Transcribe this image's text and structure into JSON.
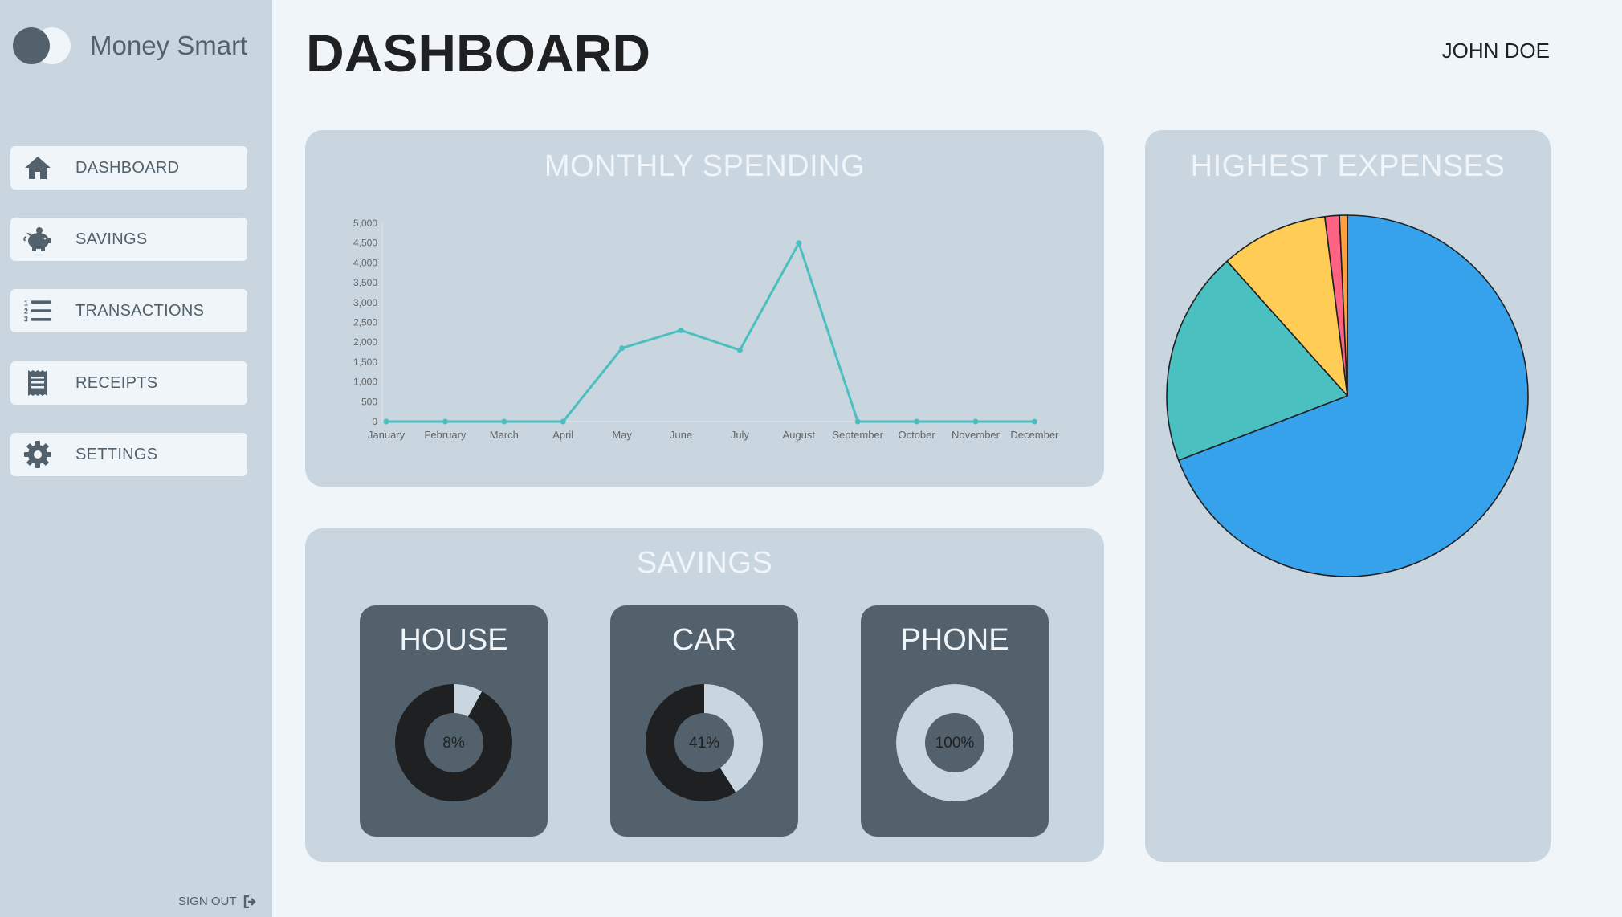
{
  "app": {
    "name": "Money Smart"
  },
  "sidebar": {
    "items": [
      {
        "label": "DASHBOARD",
        "icon": "home-icon"
      },
      {
        "label": "SAVINGS",
        "icon": "piggy-bank-icon"
      },
      {
        "label": "TRANSACTIONS",
        "icon": "numbered-list-icon"
      },
      {
        "label": "RECEIPTS",
        "icon": "receipt-icon"
      },
      {
        "label": "SETTINGS",
        "icon": "gear-icon"
      }
    ],
    "sign_out_label": "SIGN OUT"
  },
  "header": {
    "title": "DASHBOARD",
    "user": "JOHN DOE"
  },
  "colors": {
    "sidebar_bg": "#c9d6df",
    "page_bg": "#f0f5f9",
    "dark": "#52616b",
    "text": "#1e2022",
    "line": "#4bbfbf"
  },
  "monthly_spending": {
    "title": "MONTHLY SPENDING"
  },
  "highest_expenses": {
    "title": "HIGHEST EXPENSES"
  },
  "savings": {
    "title": "SAVINGS",
    "goals": [
      {
        "name": "HOUSE",
        "percent": 8,
        "label": "8%"
      },
      {
        "name": "CAR",
        "percent": 41,
        "label": "41%"
      },
      {
        "name": "PHONE",
        "percent": 100,
        "label": "100%"
      }
    ]
  },
  "chart_data": [
    {
      "type": "line",
      "title": "MONTHLY SPENDING",
      "categories": [
        "January",
        "February",
        "March",
        "April",
        "May",
        "June",
        "July",
        "August",
        "September",
        "October",
        "November",
        "December"
      ],
      "values": [
        0,
        0,
        0,
        0,
        1850,
        2300,
        1800,
        4500,
        0,
        0,
        0,
        0
      ],
      "y_ticks": [
        "0",
        "500",
        "1,000",
        "1,500",
        "2,000",
        "2,500",
        "3,000",
        "3,500",
        "4,000",
        "4,500",
        "5,000"
      ],
      "ylim": [
        0,
        5000
      ],
      "grid": false,
      "color": "#4bbfbf"
    },
    {
      "type": "pie",
      "title": "HIGHEST EXPENSES",
      "values": [
        69.2,
        19.2,
        9.6,
        1.3,
        0.7
      ],
      "colors": [
        "#36a2eb",
        "#4bc0c0",
        "#ffcd56",
        "#ff6384",
        "#ff9f40"
      ]
    }
  ]
}
